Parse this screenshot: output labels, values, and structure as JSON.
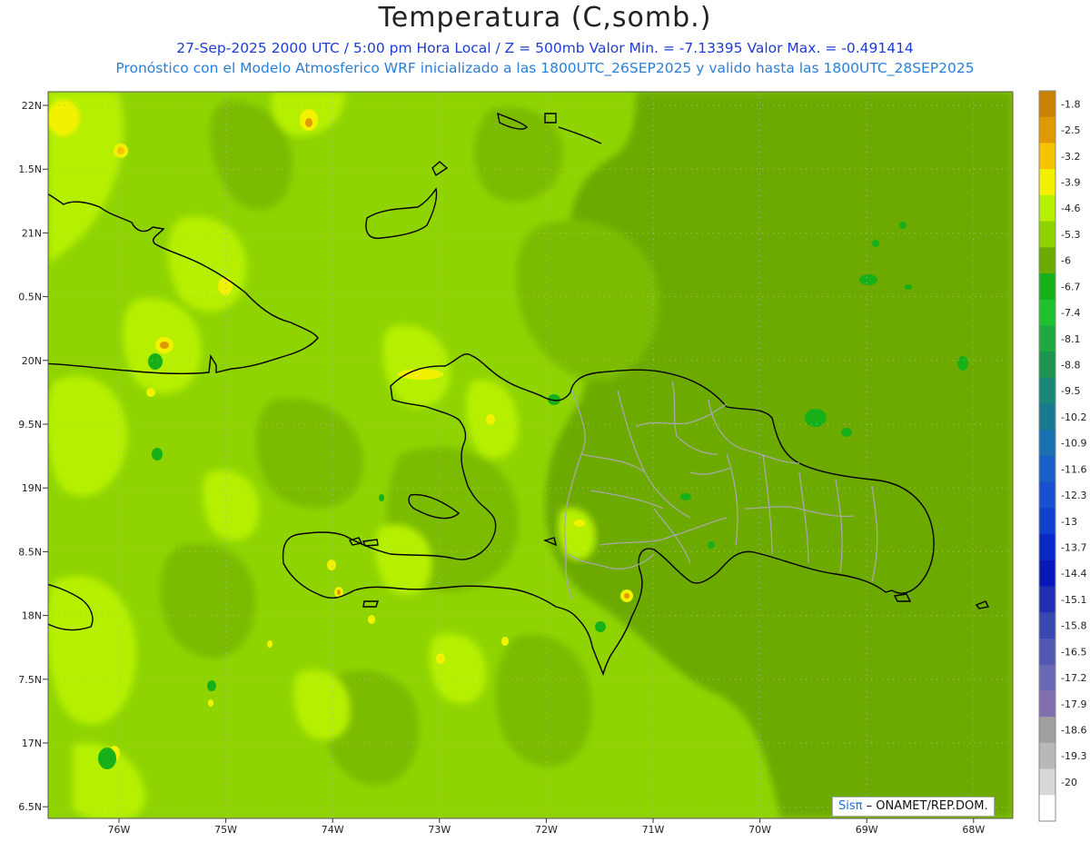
{
  "header": {
    "title": "Temperatura (C,somb.)",
    "subtitle_1": "27-Sep-2025  2000 UTC / 5:00 pm Hora Local / Z = 500mb  Valor Min. = -7.13395  Valor Max. = -0.491414",
    "subtitle_2": "Pronóstico con el Modelo Atmosferico WRF inicializado a las 1800UTC_26SEP2025 y valido hasta las  1800UTC_28SEP2025"
  },
  "axes": {
    "lat_labels": [
      "22N",
      "1.5N",
      "21N",
      "0.5N",
      "20N",
      "9.5N",
      "19N",
      "8.5N",
      "18N",
      "7.5N",
      "17N",
      "6.5N"
    ],
    "lon_labels": [
      "76W",
      "75W",
      "74W",
      "73W",
      "72W",
      "71W",
      "70W",
      "69W",
      "68W"
    ]
  },
  "colorbar": {
    "labels": [
      "-1.8",
      "-2.5",
      "-3.2",
      "-3.9",
      "-4.6",
      "-5.3",
      "-6",
      "-6.7",
      "-7.4",
      "-8.1",
      "-8.8",
      "-9.5",
      "-10.2",
      "-10.9",
      "-11.6",
      "-12.3",
      "-13",
      "-13.7",
      "-14.4",
      "-15.1",
      "-15.8",
      "-16.5",
      "-17.2",
      "-17.9",
      "-18.6",
      "-19.3",
      "-20"
    ],
    "colors": [
      "#c88200",
      "#e09a00",
      "#f6c300",
      "#f2f200",
      "#b6f000",
      "#8fd400",
      "#6caa00",
      "#18b018",
      "#20c030",
      "#20a840",
      "#1c9450",
      "#1a8878",
      "#1a7890",
      "#1870b0",
      "#1860c8",
      "#1850d0",
      "#1040d0",
      "#0828c8",
      "#0818b8",
      "#2030b0",
      "#3848b0",
      "#5058b0",
      "#6868b4",
      "#8070b0",
      "#a0a0a0",
      "#b8b8b8",
      "#d8d8d8",
      "#ffffff"
    ]
  },
  "credit": {
    "brand": "Sisπ",
    "text": "– ONAMET/REP.DOM."
  },
  "palette": {
    "bg_field": "#8fd400",
    "dark_field": "#6caa00",
    "light_field": "#b6f000",
    "coast": "#000000",
    "provinces": "#a0a0a0"
  }
}
